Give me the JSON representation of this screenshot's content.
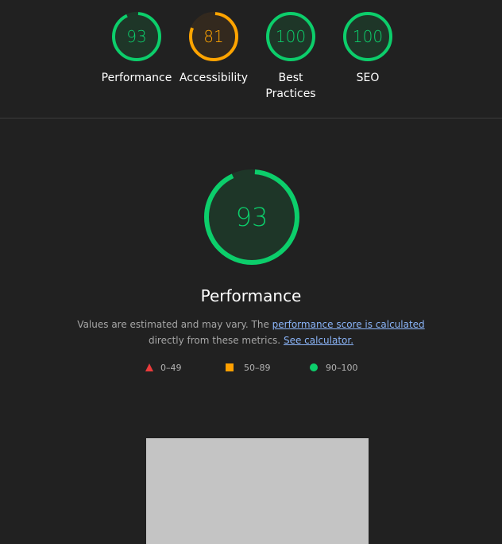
{
  "top_gauges": [
    {
      "label": "Performance",
      "score": "93",
      "value": 0.93,
      "color": "#0cce6b",
      "fill": "#1e3628"
    },
    {
      "label": "Accessibility",
      "score": "81",
      "value": 0.81,
      "color": "#ffa400",
      "fill": "#33291e"
    },
    {
      "label": "Best\nPractices",
      "score": "100",
      "value": 1.0,
      "color": "#0cce6b",
      "fill": "#1e3628"
    },
    {
      "label": "SEO",
      "score": "100",
      "value": 1.0,
      "color": "#0cce6b",
      "fill": "#1e3628"
    }
  ],
  "main": {
    "score": "93",
    "value": 0.93,
    "color": "#0cce6b",
    "title": "Performance",
    "desc_prefix": "Values are estimated and may vary. The ",
    "desc_link": "performance score is calculated",
    "desc_suffix": "directly from these metrics.",
    "calc_link": "See calculator."
  },
  "legend": [
    {
      "label": "0–49",
      "shape": "triangle",
      "color": "#eb3b3b"
    },
    {
      "label": "50–89",
      "shape": "square",
      "color": "#ffa000"
    },
    {
      "label": "90–100",
      "shape": "circle",
      "color": "#0cce6b"
    }
  ]
}
